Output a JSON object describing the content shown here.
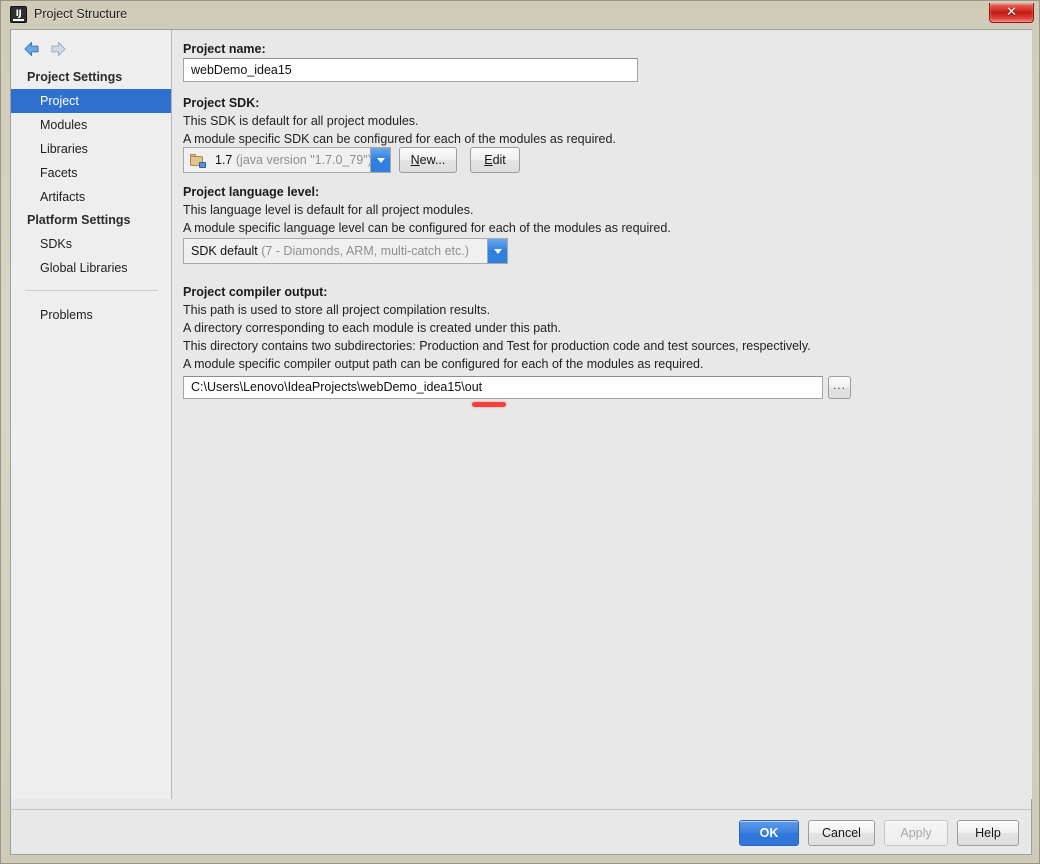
{
  "window": {
    "title": "Project Structure",
    "app_icon": "intellij-idea-icon",
    "close_label": "✕"
  },
  "sidebar": {
    "nav": {
      "back_icon": "arrow-left-icon",
      "forward_icon": "arrow-right-icon"
    },
    "groups": [
      {
        "header": "Project Settings",
        "items": [
          {
            "label": "Project",
            "selected": true
          },
          {
            "label": "Modules",
            "selected": false
          },
          {
            "label": "Libraries",
            "selected": false
          },
          {
            "label": "Facets",
            "selected": false
          },
          {
            "label": "Artifacts",
            "selected": false
          }
        ]
      },
      {
        "header": "Platform Settings",
        "items": [
          {
            "label": "SDKs",
            "selected": false
          },
          {
            "label": "Global Libraries",
            "selected": false
          }
        ]
      }
    ],
    "extra_items": [
      {
        "label": "Problems",
        "selected": false
      }
    ]
  },
  "main": {
    "project_name": {
      "label": "Project name:",
      "value": "webDemo_idea15",
      "placeholder": ""
    },
    "project_sdk": {
      "label": "Project SDK:",
      "description_line1": "This SDK is default for all project modules.",
      "description_line2": "A module specific SDK can be configured for each of the modules as required.",
      "selected_name": "1.7",
      "selected_detail": "(java version \"1.7.0_79\")",
      "icon": "jdk-folder-icon",
      "new_button": {
        "prefix": "N",
        "rest": "ew..."
      },
      "edit_button": {
        "prefix": "E",
        "rest": "dit"
      }
    },
    "language_level": {
      "label": "Project language level:",
      "description_line1": "This language level is default for all project modules.",
      "description_line2": "A module specific language level can be configured for each of the modules as required.",
      "selected_name": "SDK default",
      "selected_detail": "(7 - Diamonds, ARM, multi-catch etc.)"
    },
    "compiler_output": {
      "label": "Project compiler output:",
      "description_line1": "This path is used to store all project compilation results.",
      "description_line2": "A directory corresponding to each module is created under this path.",
      "description_line3": "This directory contains two subdirectories: Production and Test for production code and test sources, respectively.",
      "description_line4": "A module specific compiler output path can be configured for each of the modules as required.",
      "value": "C:\\Users\\Lenovo\\IdeaProjects\\webDemo_idea15\\out",
      "browse_button": "...",
      "annotation_color": "#f0433c"
    }
  },
  "footer": {
    "buttons": [
      {
        "label": "OK",
        "style": "primary"
      },
      {
        "label": "Cancel",
        "style": "normal"
      },
      {
        "label": "Apply",
        "style": "disabled"
      },
      {
        "label": "Help",
        "style": "normal"
      }
    ]
  },
  "colors": {
    "selection_blue": "#2f6fcd",
    "title_bar": "#d4d0c0",
    "panel_bg": "#e8e8e8",
    "sidebar_bg": "#eeeeee",
    "close_red": "#c21b14"
  }
}
